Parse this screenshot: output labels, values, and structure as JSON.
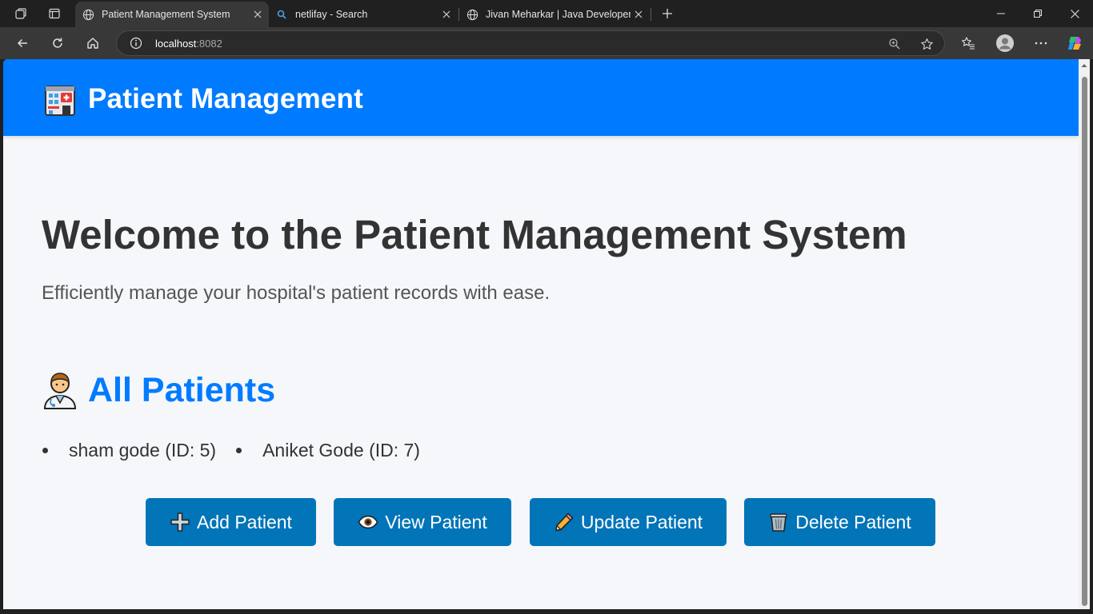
{
  "browser": {
    "tabs": [
      {
        "title": "Patient Management System",
        "active": true
      },
      {
        "title": "netlifay - Search",
        "active": false
      },
      {
        "title": "Jivan Meharkar | Java Developer",
        "active": false
      }
    ],
    "url_host": "localhost",
    "url_port": ":8082"
  },
  "header": {
    "title": "Patient Management"
  },
  "main": {
    "welcome": "Welcome to the Patient Management System",
    "tagline": "Efficiently manage your hospital's patient records with ease.",
    "patients_heading": "All Patients",
    "patients": [
      {
        "label": "sham gode (ID: 5)"
      },
      {
        "label": "Aniket Gode (ID: 7)"
      }
    ],
    "actions": {
      "add": "Add Patient",
      "view": "View Patient",
      "update": "Update Patient",
      "delete": "Delete Patient"
    }
  },
  "colors": {
    "header": "#007bff",
    "button": "#0274b8",
    "heading_accent": "#007bff"
  },
  "icons": [
    "hospital-icon",
    "doctor-icon",
    "plus-icon",
    "eye-icon",
    "pencil-icon",
    "wastebasket-icon"
  ]
}
